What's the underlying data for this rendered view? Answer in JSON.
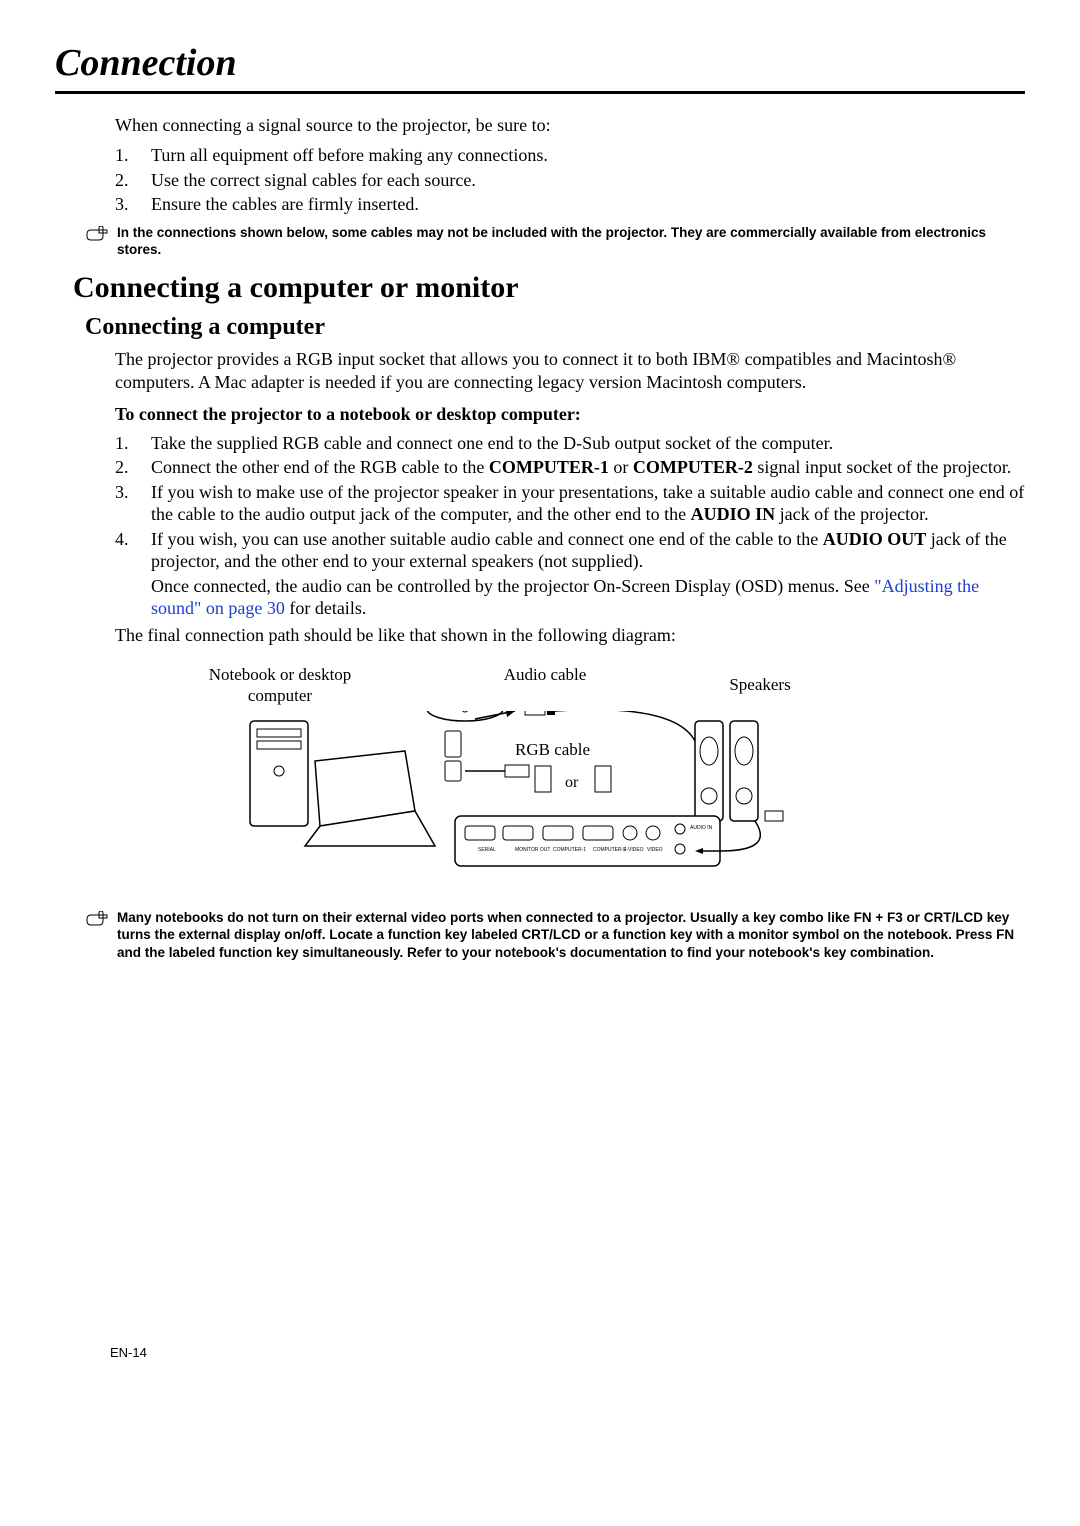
{
  "page": {
    "title": "Connection",
    "intro": "When connecting a signal source to the projector, be sure to:",
    "intro_items": [
      {
        "n": "1.",
        "t": "Turn all equipment off before making any connections."
      },
      {
        "n": "2.",
        "t": "Use the correct signal cables for each source."
      },
      {
        "n": "3.",
        "t": "Ensure the cables are firmly inserted."
      }
    ],
    "note1": "In the connections shown below, some cables may not be included with the projector. They are commercially available from electronics stores.",
    "h2": "Connecting a computer or monitor",
    "h3": "Connecting a computer",
    "p1": "The projector provides a RGB input socket that allows you to connect it to both IBM® compatibles and Macintosh® computers. A Mac adapter is needed if you are connecting legacy version Macintosh computers.",
    "h4": "To connect the projector to a notebook or desktop computer:",
    "steps": [
      {
        "n": "1.",
        "plain": "Take the supplied RGB cable and connect one end to the D-Sub output socket of the computer."
      },
      {
        "n": "2.",
        "pre": "Connect the other end of the RGB cable to the ",
        "b1": "COMPUTER-1",
        "mid": " or ",
        "b2": "COMPUTER-2",
        "post": " signal input socket of the projector."
      },
      {
        "n": "3.",
        "pre": "If you wish to make use of the projector speaker in your presentations, take a suitable audio cable and connect one end of the cable to the audio output jack of the computer, and the other end to the ",
        "b1": "AUDIO IN",
        "post": " jack of the projector."
      },
      {
        "n": "4.",
        "pre": "If you wish, you can use another suitable audio cable and connect one end of the cable to the ",
        "b1": "AUDIO OUT",
        "mid": " jack of the projector, and the other end to your external speakers (not supplied).",
        "para2_pre": "Once connected, the audio can be controlled by the projector On-Screen Display (OSD) menus. See ",
        "link": "\"Adjusting the sound\" on page 30",
        "para2_post": " for details."
      }
    ],
    "final": "The final connection path should be like that shown in the following diagram:",
    "diagram": {
      "label_notebook": "Notebook or desktop computer",
      "label_audio": "Audio cable",
      "label_speakers": "Speakers",
      "label_rgb": "RGB cable",
      "label_or": "or"
    },
    "note2": "Many notebooks do not turn on their external video ports when connected to a projector. Usually a key combo like FN + F3 or CRT/LCD key turns the external display on/off. Locate a function key labeled CRT/LCD or a function key with a monitor symbol on the notebook. Press FN and the labeled function key simultaneously. Refer to your notebook's documentation to find your notebook's key combination.",
    "page_number": "EN-14"
  }
}
